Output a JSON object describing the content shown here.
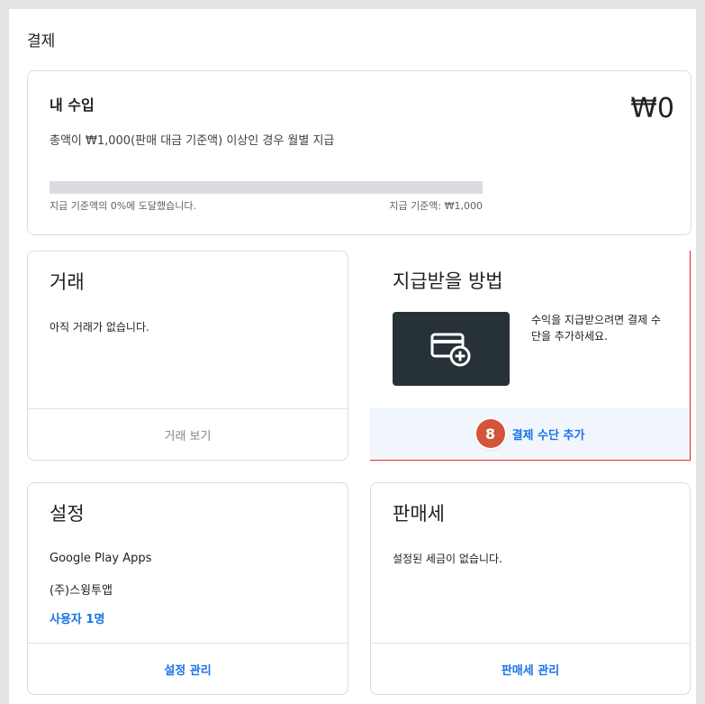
{
  "page": {
    "title": "결제"
  },
  "income": {
    "title": "내 수입",
    "balance": "₩0",
    "description": "총액이 ₩1,000(판매 대금 기준액) 이상인 경우 월별 지급",
    "progress_fraction": 0,
    "progress_left_label": "지급 기준액의 0%에 도달했습니다.",
    "progress_right_label": "지급 기준액: ₩1,000"
  },
  "transactions": {
    "title": "거래",
    "empty_text": "아직 거래가 없습니다.",
    "view_button": "거래 보기"
  },
  "payment_methods": {
    "title": "지급받을 방법",
    "icon": "card-add-icon",
    "description": "수익을 지급받으려면 결제 수단을 추가하세요.",
    "step_number": "8",
    "add_button": "결제 수단 추가"
  },
  "settings": {
    "title": "설정",
    "app_name": "Google Play Apps",
    "company": "(주)스윙투앱",
    "users_link": "사용자 1명",
    "manage_button": "설정 관리"
  },
  "sales_tax": {
    "title": "판매세",
    "empty_text": "설정된 세금이 없습니다.",
    "manage_button": "판매세 관리"
  },
  "colors": {
    "accent": "#1a73e8",
    "highlight": "#e32127",
    "step_badge": "#d2553a",
    "image_bg": "#263238"
  }
}
